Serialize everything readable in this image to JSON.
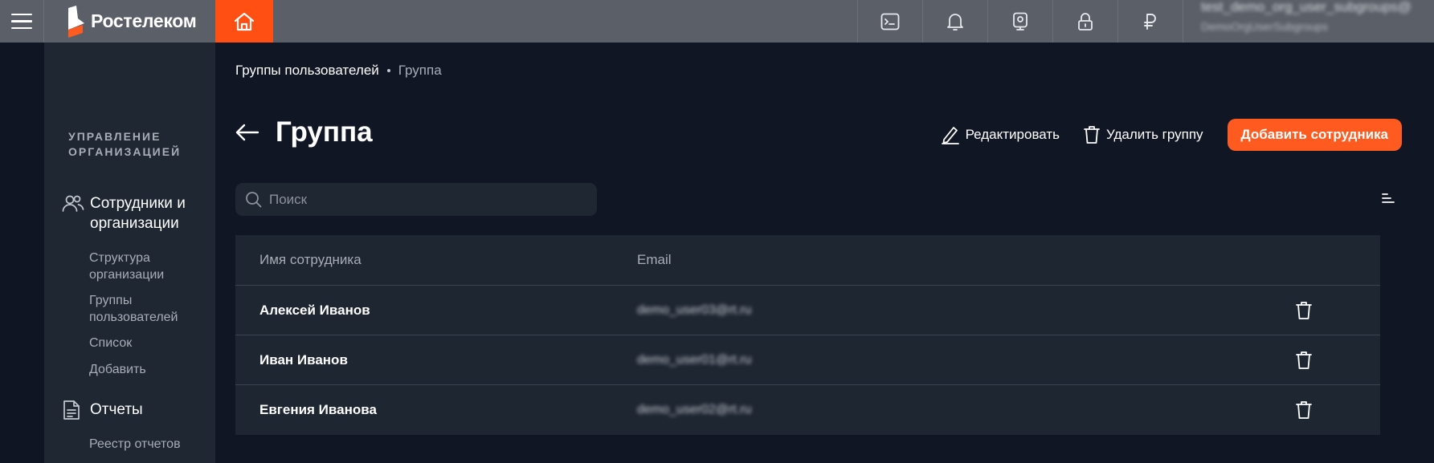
{
  "topbar": {
    "brand": "Ростелеком",
    "user_name": "test_demo_org_user_subgroups@",
    "user_org": "DemoOrgUserSubgroups",
    "icons": [
      "menu-icon",
      "home-icon",
      "terminal-icon",
      "bell-icon",
      "camera-icon",
      "lock-icon",
      "ruble-icon"
    ]
  },
  "sidebar": {
    "heading": "УПРАВЛЕНИЕ\nОРГАНИЗАЦИЕЙ",
    "groups": [
      {
        "label": "Сотрудники и организации",
        "icon": "people-icon"
      },
      {
        "label": "Отчеты",
        "icon": "document-icon"
      }
    ],
    "sub_items": [
      "Структура организации",
      "Группы пользователей",
      "Список",
      "Добавить",
      "Реестр отчетов"
    ]
  },
  "breadcrumb": {
    "parent": "Группы пользователей",
    "current": "Группа"
  },
  "page": {
    "title": "Группа"
  },
  "actions": {
    "edit_label": "Редактировать",
    "delete_label": "Удалить группу",
    "add_label": "Добавить сотрудника"
  },
  "search": {
    "placeholder": "Поиск",
    "value": ""
  },
  "table": {
    "headers": [
      "Имя сотрудника",
      "Email"
    ],
    "rows": [
      {
        "name": "Алексей Иванов",
        "email": "demo_user03@rt.ru"
      },
      {
        "name": "Иван Иванов",
        "email": "demo_user01@rt.ru"
      },
      {
        "name": "Евгения Иванова",
        "email": "demo_user02@rt.ru"
      }
    ]
  },
  "colors": {
    "accent": "#ff5a1f",
    "background": "#101624",
    "panel": "#1f2733",
    "topbar": "#5a5f68"
  }
}
